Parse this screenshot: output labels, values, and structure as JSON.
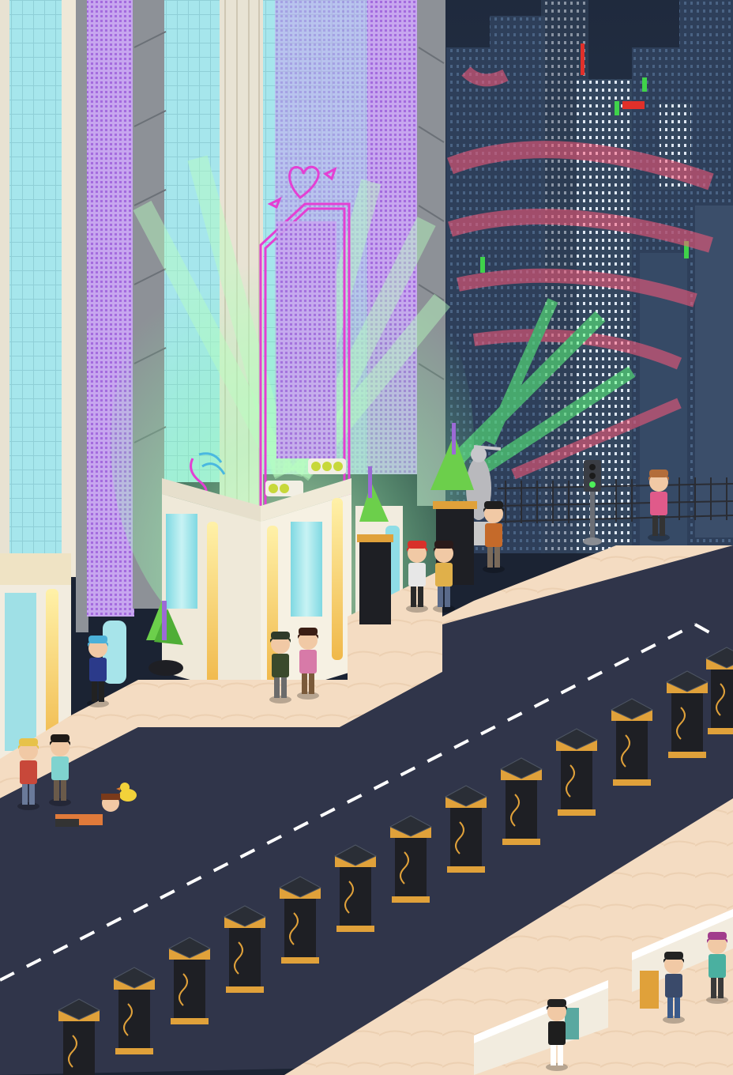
{
  "scene": {
    "title": "",
    "neon_sign": "heart",
    "billboard_text": "",
    "colors": {
      "night_sky": "#243247",
      "city_far": "#2d3d57",
      "city_near": "#34465f",
      "window_lit": "#e9eef6",
      "window_cyan": "#7fe3ea",
      "facade_cream": "#e9e4d6",
      "facade_shadow": "#c9c1ad",
      "glass": "#9fe4ea",
      "led_purple": "#b78be6",
      "neon_pink": "#e43fd3",
      "beam_green": "#7dff9f",
      "beam_red": "#ff5a7a",
      "sidewalk": "#f4dcc2",
      "road": "#30354a",
      "road_line": "#ffffff",
      "pillar_black": "#1e1f24",
      "pillar_gold": "#e0a13a",
      "plant_green": "#6ccf4b",
      "lavender": "#9c6ad6",
      "fence": "#2a2c33"
    },
    "avatars": [
      {
        "id": "blue-hair",
        "hair": "#4bb0d8",
        "shirt": "#2b3a8a",
        "pants": "#222"
      },
      {
        "id": "couple-a",
        "hair": "#2f3b2a",
        "shirt": "#3a4a2c",
        "pants": "#6b6b6b"
      },
      {
        "id": "couple-b",
        "hair": "#3b1e14",
        "shirt": "#d77aa8",
        "pants": "#7a5a3a"
      },
      {
        "id": "red-spiky",
        "hair": "#d8302a",
        "shirt": "#e7e7e7",
        "pants": "#2a2a2a"
      },
      {
        "id": "dark-bun",
        "hair": "#2a1a1a",
        "shirt": "#e0b04a",
        "pants": "#5a6a8a"
      },
      {
        "id": "orange-jacket",
        "hair": "#1f1f1f",
        "shirt": "#c56a2a",
        "pants": "#7a6a5a"
      },
      {
        "id": "pink-stripes",
        "hair": "#b36d3a",
        "shirt": "#e05a8a",
        "pants": "#333"
      },
      {
        "id": "blonde",
        "hair": "#e7c24a",
        "shirt": "#c8483a",
        "pants": "#6a7a9a"
      },
      {
        "id": "curly-dark",
        "hair": "#1f1a17",
        "shirt": "#7fd3cf",
        "pants": "#6a5a4a"
      },
      {
        "id": "lying",
        "hair": "#7a3a1a",
        "shirt": "#e07a3a",
        "pants": "#333"
      },
      {
        "id": "dark-boy",
        "hair": "#222",
        "shirt": "#3a4a6a",
        "pants": "#3a5a8a"
      },
      {
        "id": "pink-buns",
        "hair": "#a13c8c",
        "shirt": "#4ab0a0",
        "pants": "#3a3a3a"
      },
      {
        "id": "lady-black",
        "hair": "#222",
        "shirt": "#1e1e1e",
        "pants": "#ffffff"
      }
    ]
  }
}
